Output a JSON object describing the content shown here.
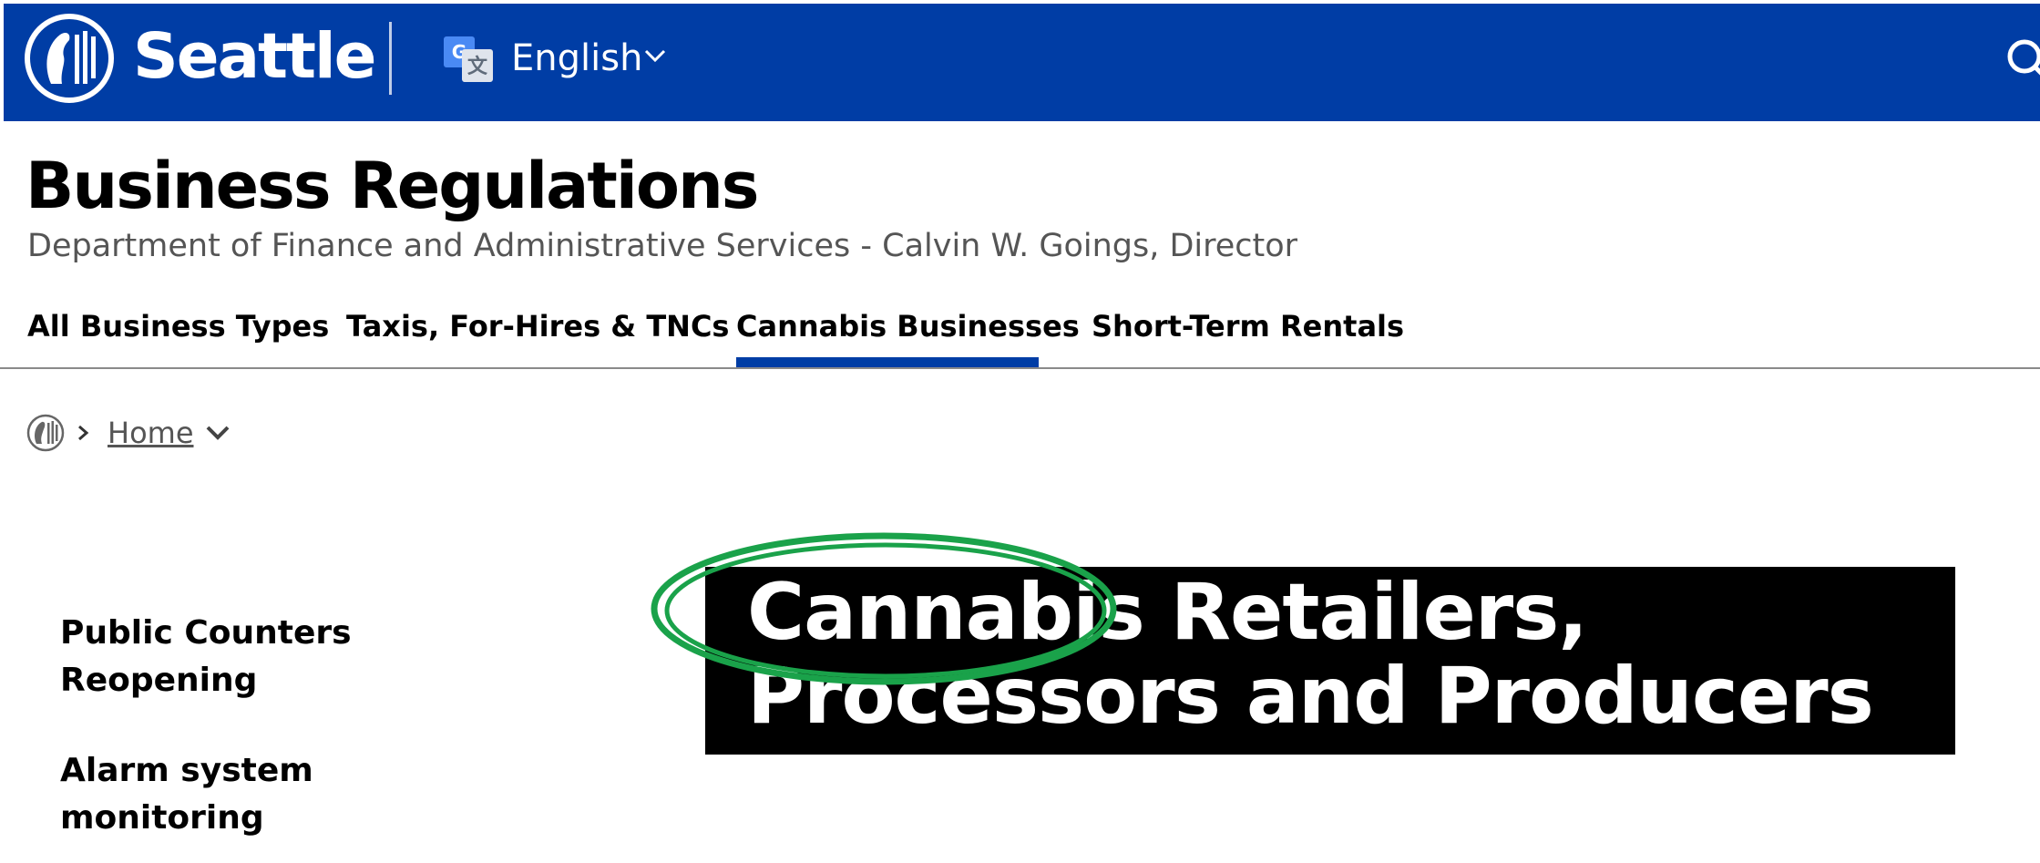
{
  "topbar": {
    "brand": "Seattle",
    "language": "English"
  },
  "header": {
    "title": "Business Regulations",
    "subtitle": "Department of Finance and Administrative Services - Calvin W. Goings, Director"
  },
  "nav": {
    "items": [
      {
        "label": "All Business Types"
      },
      {
        "label": "Taxis, For-Hires & TNCs"
      },
      {
        "label": "Cannabis Businesses",
        "active": true
      },
      {
        "label": "Short-Term Rentals"
      }
    ]
  },
  "breadcrumb": {
    "home": "Home"
  },
  "sidebar": {
    "items": [
      {
        "label": "Public Counters Reopening"
      },
      {
        "label": "Alarm system monitoring"
      }
    ]
  },
  "main": {
    "title": "Cannabis Retailers, Processors and Producers"
  },
  "colors": {
    "brand_blue": "#003da5",
    "title_bg": "#000000",
    "annotation": "#1aa24a"
  }
}
